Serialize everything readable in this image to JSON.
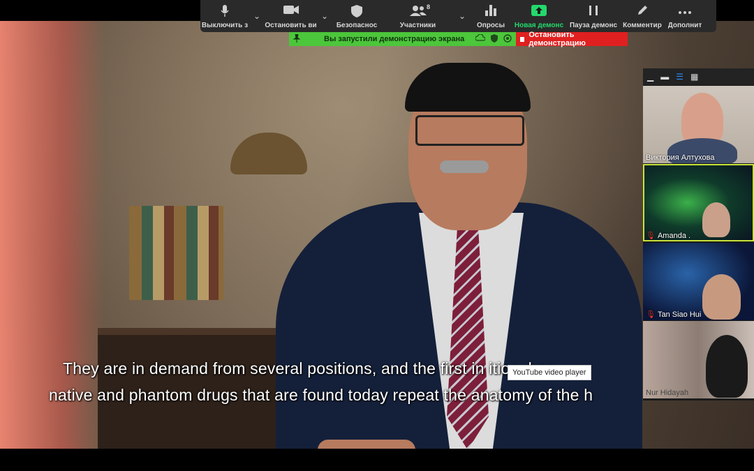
{
  "toolbar": {
    "buttons": [
      {
        "label": "Выключить з",
        "icon": "microphone-icon"
      },
      {
        "label": "Остановить ви",
        "icon": "video-camera-icon"
      },
      {
        "label": "Безопаснос",
        "icon": "security-shield-icon"
      },
      {
        "label": "Участники",
        "icon": "participants-icon",
        "badge": "8"
      },
      {
        "label": "Опросы",
        "icon": "polls-icon"
      },
      {
        "label": "Новая демонс",
        "icon": "new-share-icon"
      },
      {
        "label": "Пауза демонс",
        "icon": "pause-icon"
      },
      {
        "label": "Комментир",
        "icon": "annotate-pen-icon"
      },
      {
        "label": "Дополнит",
        "icon": "more-icon"
      }
    ]
  },
  "share_banner": {
    "message": "Вы запустили демонстрацию экрана",
    "stop_label": "Остановить демонстрацию"
  },
  "video": {
    "caption_line1": "They are in demand from several positions, and the first in  ition, bec",
    "caption_line2": "native and phantom drugs that are found today repeat the anatomy of the h",
    "tooltip": "YouTube video player"
  },
  "gallery": {
    "participants": [
      {
        "name": "Виктория Алтухова",
        "muted": false
      },
      {
        "name": "Amanda .",
        "muted": true
      },
      {
        "name": "Tan Siao Hui",
        "muted": true
      },
      {
        "name": "Nur Hidayah",
        "muted": false
      }
    ]
  },
  "colors": {
    "share_green": "#4cc63b",
    "stop_red": "#e02020",
    "active_speaker": "#c8e23a",
    "new_share_green": "#23d96b"
  }
}
